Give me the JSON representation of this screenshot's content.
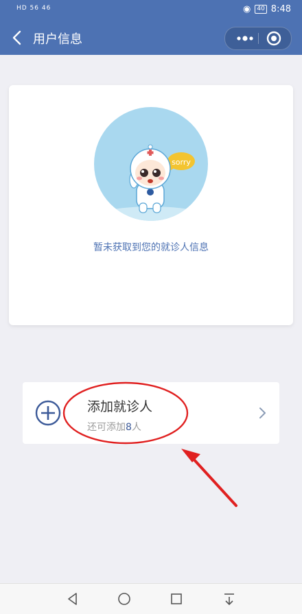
{
  "status": {
    "network_left": "HD 56 46",
    "battery": "40",
    "time": "8:48"
  },
  "nav": {
    "title": "用户信息"
  },
  "card": {
    "bubble_text": "sorry",
    "empty_message": "暂未获取到您的就诊人信息"
  },
  "add_patient": {
    "title": "添加就诊人",
    "sub_prefix": "还可添加",
    "count": "8",
    "sub_suffix": "人"
  },
  "colors": {
    "brand": "#4d72b3",
    "annotation": "#e02020"
  },
  "icons": [
    "back-arrow-icon",
    "more-dots-icon",
    "close-circle-icon",
    "plus-circle-icon",
    "chevron-right-icon",
    "nav-back-icon",
    "nav-home-icon",
    "nav-recent-icon",
    "nav-download-icon"
  ]
}
